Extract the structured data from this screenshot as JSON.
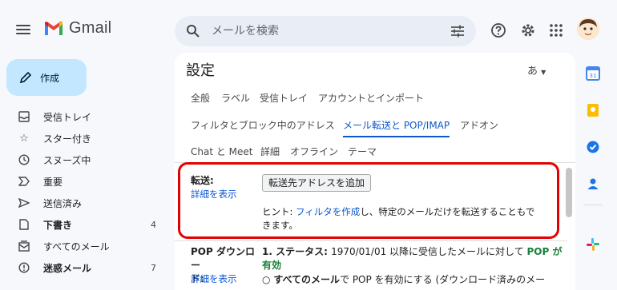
{
  "header": {
    "app_name": "Gmail",
    "search_placeholder": "メールを検索"
  },
  "compose": {
    "label": "作成"
  },
  "sidebar": {
    "items": [
      {
        "label": "受信トレイ",
        "count": ""
      },
      {
        "label": "スター付き",
        "count": ""
      },
      {
        "label": "スヌーズ中",
        "count": ""
      },
      {
        "label": "重要",
        "count": ""
      },
      {
        "label": "送信済み",
        "count": ""
      },
      {
        "label": "下書き",
        "count": "4"
      },
      {
        "label": "すべてのメール",
        "count": ""
      },
      {
        "label": "迷惑メール",
        "count": "7"
      }
    ]
  },
  "settings": {
    "title": "設定",
    "language_indicator": "あ",
    "tabs_row1": [
      "全般",
      "ラベル",
      "受信トレイ",
      "アカウントとインポート"
    ],
    "tabs_row2": [
      "フィルタとブロック中のアドレス",
      "メール転送と POP/IMAP",
      "アドオン"
    ],
    "tabs_row3": [
      "Chat と Meet",
      "詳細",
      "オフライン",
      "テーマ"
    ],
    "forwarding": {
      "label": "転送:",
      "details_link": "詳細を表示",
      "add_button": "転送先アドレスを追加",
      "hint_prefix": "ヒント: ",
      "hint_link": "フィルタを作成",
      "hint_suffix_line1": "し、特定のメールだけを転送することもで",
      "hint_suffix_line2": "きます。"
    },
    "pop": {
      "label_line1": "POP ダウンロー",
      "label_line2": "ド:",
      "details_link": "詳細を表示",
      "status_prefix": "1. ステータス: ",
      "status_text": "1970/01/01 以降に受信したメールに対して ",
      "status_pop": "POP が",
      "status_enabled": "有効",
      "option_bold": "すべてのメール",
      "option_rest": "で POP を有効にする (ダウンロード済みのメー"
    }
  },
  "colors": {
    "accent": "#0b57d0",
    "highlight_box": "#e50000",
    "compose_bg": "#c2e7ff",
    "enabled_green": "#188038"
  }
}
